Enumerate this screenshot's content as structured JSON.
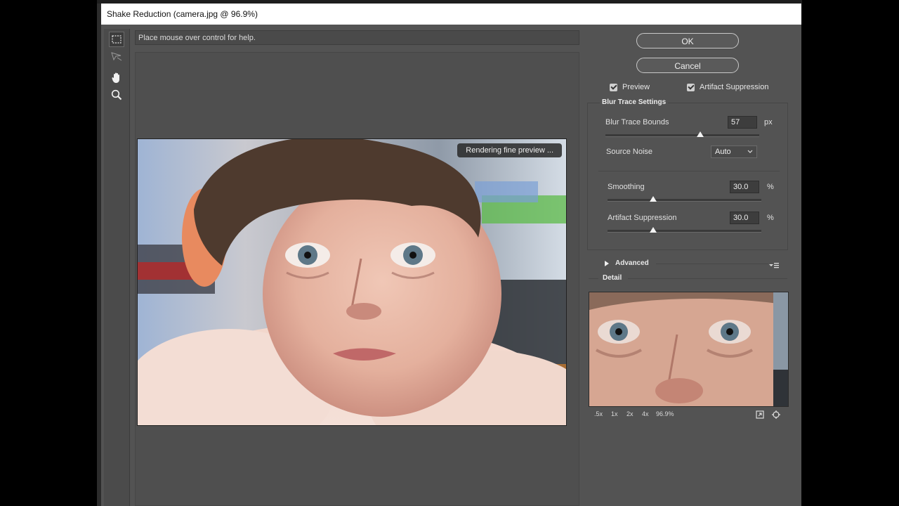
{
  "window": {
    "title": "Shake Reduction (camera.jpg @ 96.9%)"
  },
  "help_text": "Place mouse over control for help.",
  "preview_toast": "Rendering fine preview ...",
  "buttons": {
    "ok": "OK",
    "cancel": "Cancel"
  },
  "options": {
    "preview": {
      "label": "Preview",
      "checked": true
    },
    "artifact_suppression": {
      "label": "Artifact Suppression",
      "checked": true
    }
  },
  "blur_trace": {
    "title": "Blur Trace Settings",
    "bounds": {
      "label": "Blur Trace Bounds",
      "value": "57",
      "unit": "px"
    },
    "source_noise": {
      "label": "Source Noise",
      "value": "Auto"
    },
    "smoothing": {
      "label": "Smoothing",
      "value": "30.0",
      "unit": "%"
    },
    "artifact": {
      "label": "Artifact Suppression",
      "value": "30.0",
      "unit": "%"
    }
  },
  "advanced": {
    "label": "Advanced"
  },
  "detail": {
    "title": "Detail",
    "zoom": [
      ".5x",
      "1x",
      "2x",
      "4x",
      "96.9%"
    ]
  },
  "colors": {
    "panel": "#535353",
    "field": "#3d3d3d",
    "accent": "#f4f4f4"
  }
}
